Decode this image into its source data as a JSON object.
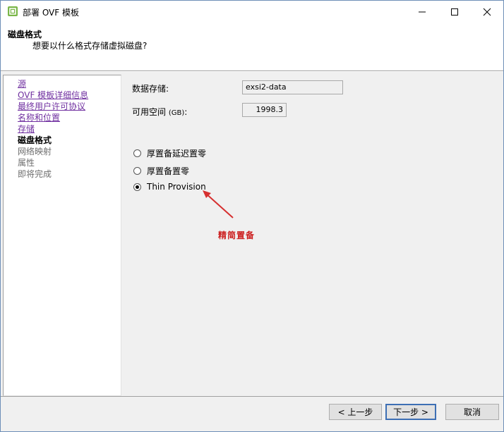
{
  "window": {
    "title": "部署 OVF 模板",
    "controls": {
      "minimize": "minimize",
      "maximize": "maximize",
      "close": "close"
    }
  },
  "header": {
    "title": "磁盘格式",
    "subtitle": "想要以什么格式存储虚拟磁盘?"
  },
  "nav": {
    "items": [
      {
        "label": "源",
        "state": "link"
      },
      {
        "label": "OVF 模板详细信息",
        "state": "link"
      },
      {
        "label": "最终用户许可协议",
        "state": "link"
      },
      {
        "label": "名称和位置",
        "state": "link"
      },
      {
        "label": "存储",
        "state": "link"
      },
      {
        "label": "磁盘格式",
        "state": "current"
      },
      {
        "label": "网络映射",
        "state": "disabled"
      },
      {
        "label": "属性",
        "state": "disabled"
      },
      {
        "label": "即将完成",
        "state": "disabled"
      }
    ]
  },
  "content": {
    "datastore_label": "数据存储:",
    "datastore_value": "exsi2-data",
    "free_space_label": "可用空间",
    "free_space_unit": "(GB)",
    "free_space_colon": ":",
    "free_space_value": "1998.3",
    "options": [
      {
        "label": "厚置备延迟置零",
        "selected": false
      },
      {
        "label": "厚置备置零",
        "selected": false
      },
      {
        "label": "Thin Provision",
        "selected": true
      }
    ],
    "annotation": "精简置备",
    "annotation_color": "#cc1f1f"
  },
  "footer": {
    "back_label": "< 上一步",
    "next_label": "下一步 >",
    "cancel_label": "取消"
  }
}
